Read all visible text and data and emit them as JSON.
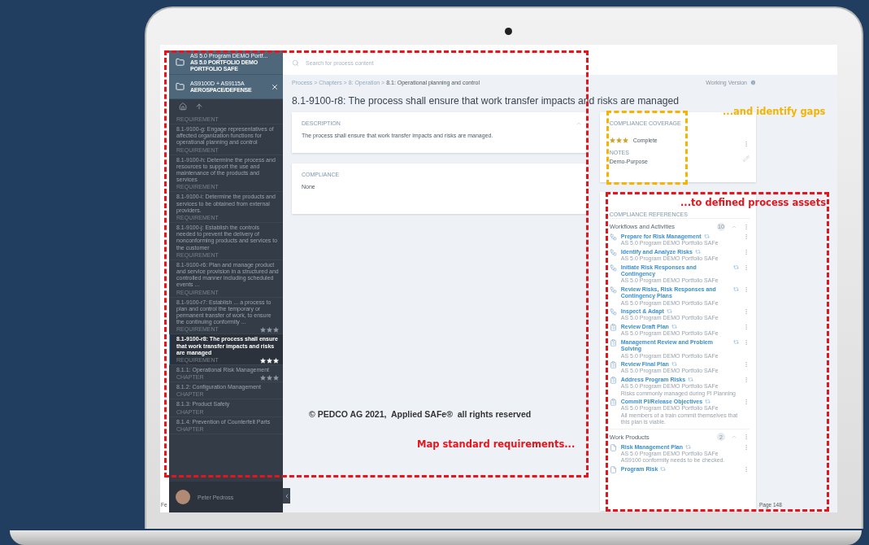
{
  "sidebar": {
    "projects": [
      {
        "title": "AS 5.0 Program DEMO Portf...",
        "subtitle": "AS 5.0 PORTFOLIO DEMO PORTFOLIO SAFE",
        "closable": false
      },
      {
        "title": "AS9100D + AS9115A",
        "subtitle": "AEROSPACE/DEFENSE",
        "closable": true
      }
    ],
    "items": [
      {
        "label": "REQUIREMENT",
        "selected": false
      },
      {
        "text": "8.1-9100-g: Engage representatives of affected organization functions for operational planning and control",
        "label": "REQUIREMENT",
        "selected": false
      },
      {
        "text": "8.1-9100-h: Determine the process and resources to support the use and maintenance of the products and services",
        "label": "REQUIREMENT",
        "selected": false
      },
      {
        "text": "8.1-9100-i: Determine the products and services to be obtained from external providers.",
        "label": "REQUIREMENT",
        "selected": false
      },
      {
        "text": "8.1-9100-j: Establish the controls needed to prevent the delivery of nonconforming products and services to the customer",
        "label": "REQUIREMENT",
        "selected": false
      },
      {
        "text": "8.1-9100-r6: Plan and manage product and service provision in a structured and controlled manner including scheduled events ...",
        "label": "REQUIREMENT",
        "selected": false
      },
      {
        "text": "8.1-9100-r7: Establish ... a process to plan and control the temporary or permanent transfer of work, to ensure the continuing conformity ...",
        "label": "REQUIREMENT",
        "selected": false,
        "stars": 3
      },
      {
        "text": "8.1-9100-r8: The process shall ensure that work transfer impacts and risks are managed",
        "label": "REQUIREMENT",
        "selected": true,
        "stars": 3
      },
      {
        "text": "8.1.1: Operational Risk Management",
        "label": "CHAPTER",
        "selected": false,
        "stars": 3
      },
      {
        "text": "8.1.2: Configuration Management",
        "label": "CHAPTER",
        "selected": false
      },
      {
        "text": "8.1.3: Product Safety",
        "label": "CHAPTER",
        "selected": false
      },
      {
        "text": "8.1.4: Prevention of Counterfeit Parts",
        "label": "CHAPTER",
        "selected": false
      }
    ],
    "user": "Peter Pedross"
  },
  "search": {
    "placeholder": "Search for process content"
  },
  "breadcrumb": "Process > Chapters > 8: Operation > **8.1: Operational planning and control**",
  "version": "Working Version",
  "title": "8.1-9100-r8: The process shall ensure that work transfer impacts and risks are managed",
  "description": {
    "label": "DESCRIPTION",
    "text": "The process shall ensure that work transfer impacts and risks are managed.",
    "expanded": true
  },
  "compliance": {
    "label": "COMPLIANCE",
    "value": "None"
  },
  "coverage": {
    "label": "COMPLIANCE COVERAGE",
    "stars": 3,
    "status": "Complete",
    "notes_label": "NOTES",
    "notes": "Demo-Purpose"
  },
  "references": {
    "label": "COMPLIANCE REFERENCES",
    "groups": [
      {
        "title": "Workflows and Activities",
        "count": "10",
        "expanded": true,
        "items": [
          {
            "kind": "workflow",
            "title": "Prepare for Risk Management",
            "source": "AS 5.0 Program DEMO Portfolio SAFe"
          },
          {
            "kind": "workflow",
            "title": "Identify and Analyze Risks",
            "source": "AS 5.0 Program DEMO Portfolio SAFe"
          },
          {
            "kind": "workflow",
            "title": "Initiate Risk Responses and Contingency",
            "source": "AS 5.0 Program DEMO Portfolio SAFe"
          },
          {
            "kind": "workflow",
            "title": "Review Risks, Risk Responses and Contingency Plans",
            "source": "AS 5.0 Program DEMO Portfolio SAFe"
          },
          {
            "kind": "workflow",
            "title": "Inspect & Adapt",
            "source": "AS 5.0 Program DEMO Portfolio SAFe"
          },
          {
            "kind": "activity",
            "title": "Review Draft Plan",
            "source": "AS 5.0 Program DEMO Portfolio SAFe"
          },
          {
            "kind": "activity",
            "title": "Management Review and Problem Solving",
            "source": "AS 5.0 Program DEMO Portfolio SAFe"
          },
          {
            "kind": "activity",
            "title": "Review Final Plan",
            "source": "AS 5.0 Program DEMO Portfolio SAFe"
          },
          {
            "kind": "activity",
            "title": "Address Program Risks",
            "source": "AS 5.0 Program DEMO Portfolio SAFe",
            "note": "Risks commonly managed during PI Planning"
          },
          {
            "kind": "activity",
            "title": "Commit PI/Release Objectives",
            "source": "AS 5.0 Program DEMO Portfolio SAFe",
            "note": "All members of a train commit themselves that this plan is viable."
          }
        ]
      },
      {
        "title": "Work Products",
        "count": "2",
        "expanded": true,
        "items": [
          {
            "kind": "document",
            "title": "Risk Management Plan",
            "source": "AS 5.0 Program DEMO Portfolio SAFe",
            "note": "AS9100 conformity needs to be checked."
          },
          {
            "kind": "document",
            "title": "Program Risk"
          }
        ]
      }
    ]
  },
  "footer": {
    "left": "Fe",
    "right": "Page 148"
  },
  "copyright": "© PEDCO AG 2021,  Applied SAFe®  all rights reserved",
  "annotations": [
    {
      "label": "Map standard requirements...",
      "color": "#e8141b"
    },
    {
      "label": "...and identify gaps",
      "color": "#f5b400"
    },
    {
      "label": "...to defined process assets",
      "color": "#e8141b"
    }
  ]
}
